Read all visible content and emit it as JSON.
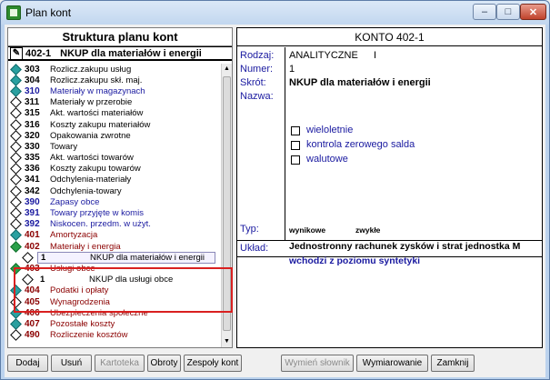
{
  "window": {
    "title": "Plan kont"
  },
  "tree": {
    "header": "Struktura planu kont",
    "selected": {
      "code": "402-1",
      "name": "NKUP dla materiałów i energii"
    },
    "rows": [
      {
        "code": "303",
        "name": "Rozlicz.zakupu usług",
        "icon": "teal",
        "color": "#000000"
      },
      {
        "code": "304",
        "name": "Rozlicz.zakupu skł. maj.",
        "icon": "teal",
        "color": "#000000"
      },
      {
        "code": "310",
        "name": "Materiały w magazynach",
        "icon": "teal",
        "color": "#1a1aa0"
      },
      {
        "code": "311",
        "name": "Materiały w przerobie",
        "icon": "empty",
        "color": "#000000"
      },
      {
        "code": "315",
        "name": "Akt. wartości materiałów",
        "icon": "empty",
        "color": "#000000"
      },
      {
        "code": "316",
        "name": "Koszty zakupu materiałów",
        "icon": "empty",
        "color": "#000000"
      },
      {
        "code": "320",
        "name": "Opakowania zwrotne",
        "icon": "empty",
        "color": "#000000"
      },
      {
        "code": "330",
        "name": "Towary",
        "icon": "empty",
        "color": "#000000"
      },
      {
        "code": "335",
        "name": "Akt. wartości towarów",
        "icon": "empty",
        "color": "#000000"
      },
      {
        "code": "336",
        "name": "Koszty zakupu towarów",
        "icon": "empty",
        "color": "#000000"
      },
      {
        "code": "341",
        "name": "Odchylenia-materiały",
        "icon": "empty",
        "color": "#000000"
      },
      {
        "code": "342",
        "name": "Odchylenia-towary",
        "icon": "empty",
        "color": "#000000"
      },
      {
        "code": "390",
        "name": "Zapasy obce",
        "icon": "empty",
        "color": "#1a1aa0"
      },
      {
        "code": "391",
        "name": "Towary przyjęte w komis",
        "icon": "empty",
        "color": "#1a1aa0"
      },
      {
        "code": "392",
        "name": "Niskocen. przedm. w użyt.",
        "icon": "empty",
        "color": "#1a1aa0"
      },
      {
        "code": "401",
        "name": "Amortyzacja",
        "icon": "teal",
        "color": "#8b0000"
      },
      {
        "code": "402",
        "name": "Materiały i energia",
        "icon": "green",
        "color": "#8b0000"
      },
      {
        "sub": true,
        "code": "1",
        "name": "NKUP dla materiałów i energii",
        "selected": true
      },
      {
        "code": "403",
        "name": "Usługi obce",
        "icon": "green",
        "color": "#8b0000"
      },
      {
        "sub": true,
        "code": "1",
        "name": "NKUP dla usługi obce",
        "selected": false
      },
      {
        "code": "404",
        "name": "Podatki i opłaty",
        "icon": "teal",
        "color": "#8b0000"
      },
      {
        "code": "405",
        "name": "Wynagrodzenia",
        "icon": "empty",
        "color": "#8b0000"
      },
      {
        "code": "406",
        "name": "Ubezpieczenia społeczne",
        "icon": "teal",
        "color": "#8b0000"
      },
      {
        "code": "407",
        "name": "Pozostałe koszty",
        "icon": "teal",
        "color": "#8b0000"
      },
      {
        "code": "490",
        "name": "Rozliczenie kosztów",
        "icon": "empty",
        "color": "#8b0000"
      }
    ]
  },
  "detail": {
    "title": "KONTO 402-1",
    "labels": {
      "rodzaj": "Rodzaj:",
      "numer": "Numer:",
      "skrot": "Skrót:",
      "nazwa": "Nazwa:",
      "typ": "Typ:",
      "uklad": "Układ:"
    },
    "rodzaj_value": "ANALITYCZNE",
    "rodzaj_level": "I",
    "numer_value": "1",
    "skrot_value": "NKUP dla materiałów i energii",
    "checkboxes": [
      {
        "label": "wieloletnie",
        "checked": false
      },
      {
        "label": "kontrola zerowego salda",
        "checked": false
      },
      {
        "label": "walutowe",
        "checked": false
      }
    ],
    "typ_values": [
      "wynikowe",
      "zwykłe"
    ],
    "uklad_line1": "Jednostronny rachunek zysków i strat jednostka M",
    "uklad_line2": "wchodzi z poziomu syntetyki"
  },
  "buttons": {
    "dodaj": "Dodaj",
    "usun": "Usuń",
    "kartoteka": "Kartoteka",
    "obroty": "Obroty",
    "zespoly": "Zespoły kont",
    "wymien": "Wymień słownik",
    "wymiarowanie": "Wymiarowanie",
    "zamknij": "Zamknij"
  }
}
